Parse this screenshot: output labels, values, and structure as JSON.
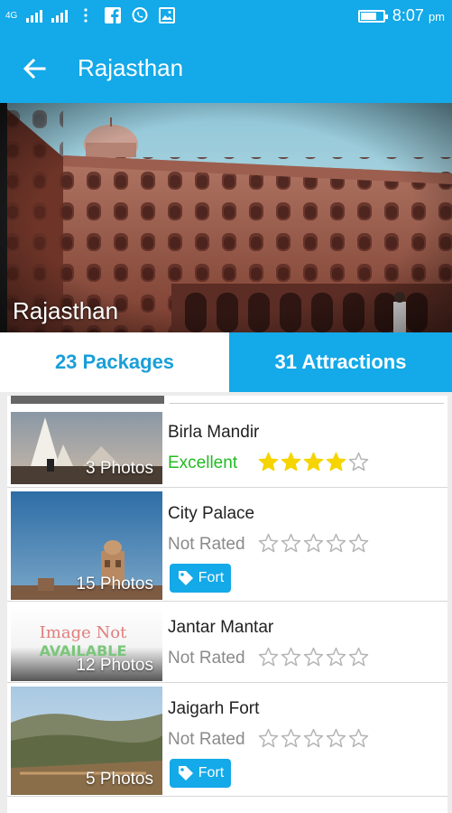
{
  "statusbar": {
    "network_label": "4G",
    "time": "8:07",
    "ampm": "pm",
    "battery_level": 0.7,
    "icons": [
      "signal-icon",
      "signal-icon",
      "more-vert-icon",
      "facebook-icon",
      "whatsapp-icon",
      "image-icon",
      "battery-icon"
    ]
  },
  "appbar": {
    "title": "Rajasthan",
    "back_icon": "arrow-left-icon"
  },
  "hero": {
    "title": "Rajasthan"
  },
  "tabs": [
    {
      "label": "23 Packages",
      "selected": false
    },
    {
      "label": "31 Attractions",
      "selected": true
    }
  ],
  "attractions": [
    {
      "name": "Birla Mandir",
      "photos": "3 Photos",
      "rating_label": "Excellent",
      "stars": 4,
      "tag": ""
    },
    {
      "name": "City Palace",
      "photos": "15 Photos",
      "rating_label": "Not Rated",
      "stars": 0,
      "tag": "Fort"
    },
    {
      "name": "Jantar Mantar",
      "photos": "12 Photos",
      "rating_label": "Not Rated",
      "stars": 0,
      "tag": "",
      "placeholder_image_text": [
        "Image Not",
        "AVAILABLE"
      ]
    },
    {
      "name": "Jaigarh Fort",
      "photos": "5 Photos",
      "rating_label": "Not Rated",
      "stars": 0,
      "tag": "Fort"
    }
  ],
  "colors": {
    "primary": "#14a9e8",
    "excellent": "#22bb22",
    "star_filled": "#f5d400",
    "not_rated": "#8a8a8a"
  }
}
